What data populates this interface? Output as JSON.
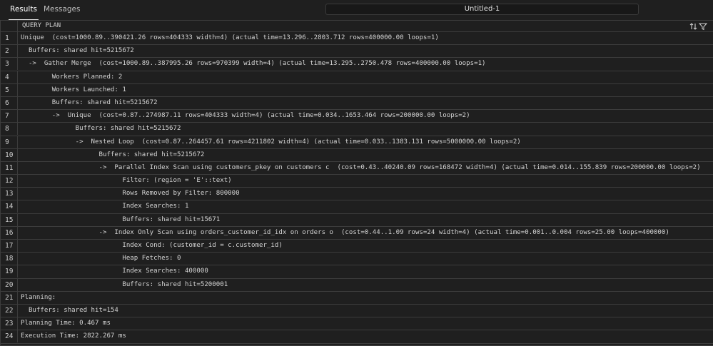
{
  "tabs": [
    {
      "label": "Results"
    },
    {
      "label": "Messages"
    }
  ],
  "title": "Untitled-1",
  "grid": {
    "column_header": "QUERY PLAN",
    "rows": [
      {
        "num": "1",
        "text": "Unique  (cost=1000.89..390421.26 rows=404333 width=4) (actual time=13.296..2803.712 rows=400000.00 loops=1)"
      },
      {
        "num": "2",
        "text": "  Buffers: shared hit=5215672"
      },
      {
        "num": "3",
        "text": "  ->  Gather Merge  (cost=1000.89..387995.26 rows=970399 width=4) (actual time=13.295..2750.478 rows=400000.00 loops=1)"
      },
      {
        "num": "4",
        "text": "        Workers Planned: 2"
      },
      {
        "num": "5",
        "text": "        Workers Launched: 1"
      },
      {
        "num": "6",
        "text": "        Buffers: shared hit=5215672"
      },
      {
        "num": "7",
        "text": "        ->  Unique  (cost=0.87..274987.11 rows=404333 width=4) (actual time=0.034..1653.464 rows=200000.00 loops=2)"
      },
      {
        "num": "8",
        "text": "              Buffers: shared hit=5215672"
      },
      {
        "num": "9",
        "text": "              ->  Nested Loop  (cost=0.87..264457.61 rows=4211802 width=4) (actual time=0.033..1383.131 rows=5000000.00 loops=2)"
      },
      {
        "num": "10",
        "text": "                    Buffers: shared hit=5215672"
      },
      {
        "num": "11",
        "text": "                    ->  Parallel Index Scan using customers_pkey on customers c  (cost=0.43..40240.09 rows=168472 width=4) (actual time=0.014..155.839 rows=200000.00 loops=2)"
      },
      {
        "num": "12",
        "text": "                          Filter: (region = 'E'::text)"
      },
      {
        "num": "13",
        "text": "                          Rows Removed by Filter: 800000"
      },
      {
        "num": "14",
        "text": "                          Index Searches: 1"
      },
      {
        "num": "15",
        "text": "                          Buffers: shared hit=15671"
      },
      {
        "num": "16",
        "text": "                    ->  Index Only Scan using orders_customer_id_idx on orders o  (cost=0.44..1.09 rows=24 width=4) (actual time=0.001..0.004 rows=25.00 loops=400000)"
      },
      {
        "num": "17",
        "text": "                          Index Cond: (customer_id = c.customer_id)"
      },
      {
        "num": "18",
        "text": "                          Heap Fetches: 0"
      },
      {
        "num": "19",
        "text": "                          Index Searches: 400000"
      },
      {
        "num": "20",
        "text": "                          Buffers: shared hit=5200001"
      },
      {
        "num": "21",
        "text": "Planning:"
      },
      {
        "num": "22",
        "text": "  Buffers: shared hit=154"
      },
      {
        "num": "23",
        "text": "Planning Time: 0.467 ms"
      },
      {
        "num": "24",
        "text": "Execution Time: 2822.267 ms"
      }
    ]
  },
  "icons": {
    "sort": "sort-icon",
    "filter": "filter-icon"
  },
  "colors": {
    "background": "#1f1f1f",
    "border": "#3c3c3c",
    "text": "#d4d4d4",
    "active_tab_underline": "#e7e7e7"
  }
}
